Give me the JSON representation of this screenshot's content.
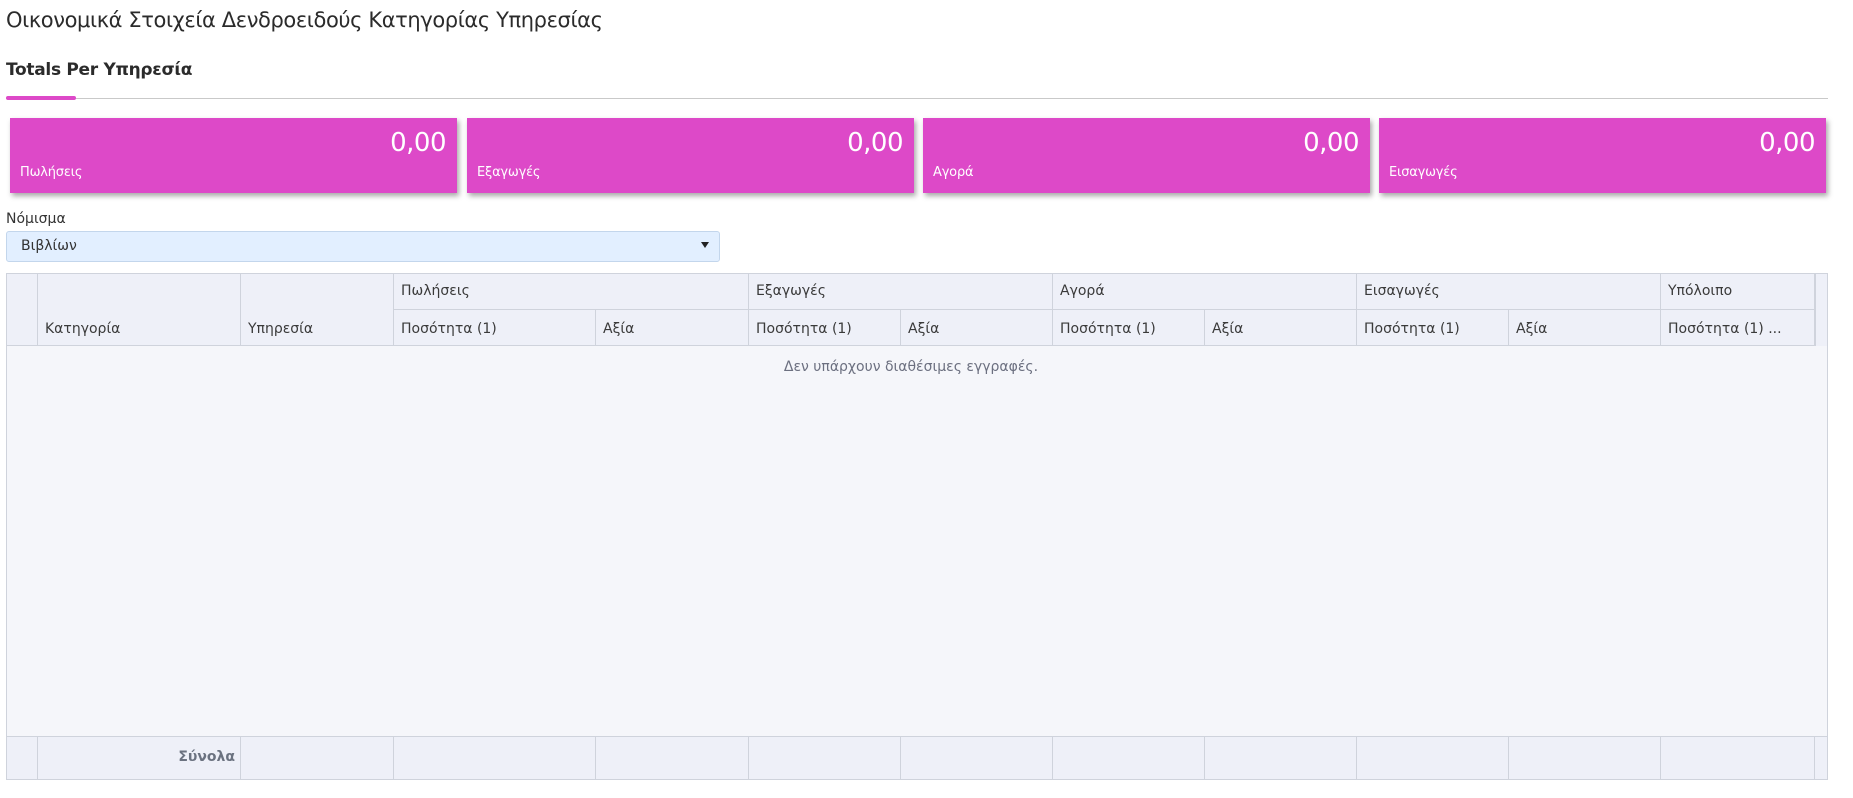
{
  "page": {
    "title": "Οικονομικά Στοιχεία Δενδροειδούς Κατηγορίας Υπηρεσίας"
  },
  "tabs": [
    {
      "label": "Totals Per Υπηρεσία",
      "active": true
    }
  ],
  "cards": [
    {
      "value": "0,00",
      "label": "Πωλήσεις"
    },
    {
      "value": "0,00",
      "label": "Εξαγωγές"
    },
    {
      "value": "0,00",
      "label": "Αγορά"
    },
    {
      "value": "0,00",
      "label": "Εισαγωγές"
    }
  ],
  "currency": {
    "label": "Νόμισμα",
    "value": "Βιβλίων"
  },
  "grid": {
    "columns": {
      "category": "Κατηγορία",
      "service": "Υπηρεσία"
    },
    "groups": [
      {
        "label": "Πωλήσεις",
        "qty": "Ποσότητα (1)",
        "val": "Αξία"
      },
      {
        "label": "Εξαγωγές",
        "qty": "Ποσότητα (1)",
        "val": "Αξία"
      },
      {
        "label": "Αγορά",
        "qty": "Ποσότητα (1)",
        "val": "Αξία"
      },
      {
        "label": "Εισαγωγές",
        "qty": "Ποσότητα (1)",
        "val": "Αξία"
      },
      {
        "label": "Υπόλοιπο",
        "qty": "Ποσότητα (1) ..."
      }
    ],
    "empty_message": "Δεν υπάρχουν διαθέσιμες εγγραφές.",
    "footer_label": "Σύνολα"
  },
  "colors": {
    "accent": "#dd49c8",
    "select_bg": "#e2efff",
    "grid_header_bg": "#eef0f8"
  }
}
